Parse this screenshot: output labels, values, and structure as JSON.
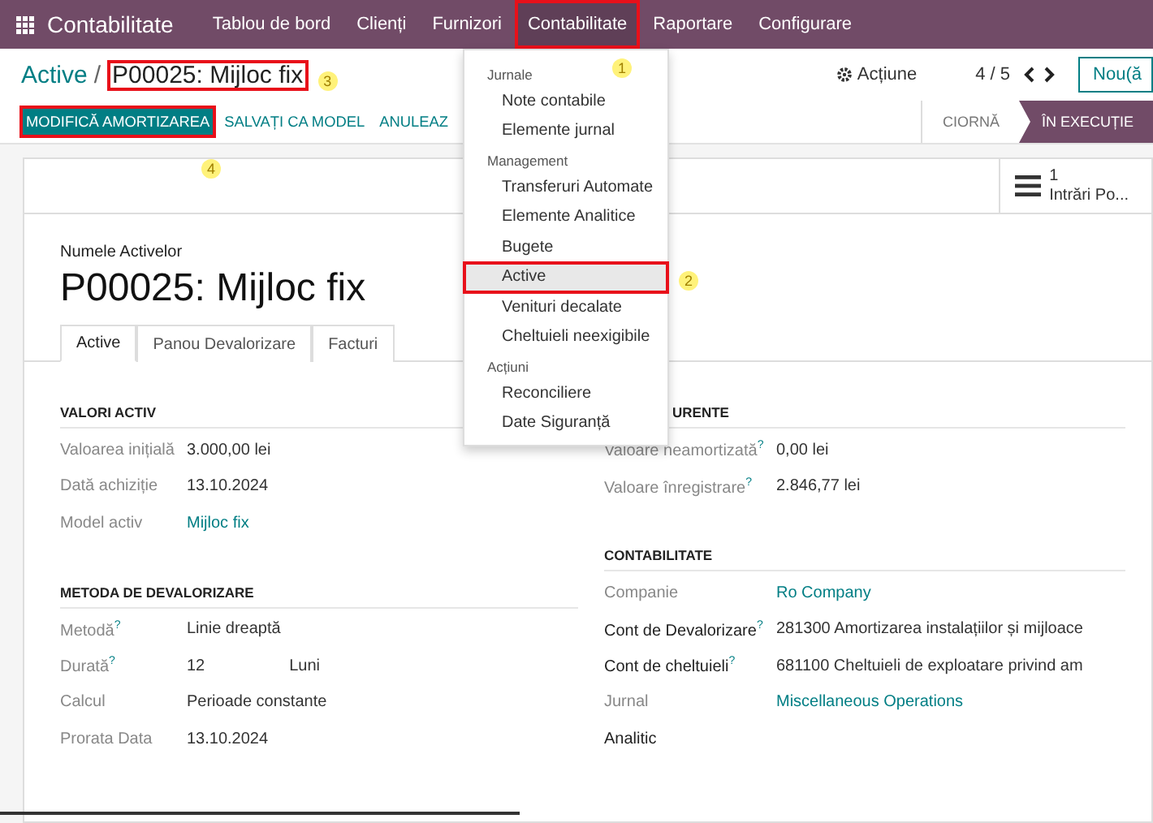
{
  "navbar": {
    "app_name": "Contabilitate",
    "items": [
      {
        "label": "Tablou de bord",
        "selected": false
      },
      {
        "label": "Clienți",
        "selected": false
      },
      {
        "label": "Furnizori",
        "selected": false
      },
      {
        "label": "Contabilitate",
        "selected": true,
        "highlighted": true,
        "callout": "1"
      },
      {
        "label": "Raportare",
        "selected": false
      },
      {
        "label": "Configurare",
        "selected": false
      }
    ]
  },
  "dropdown": {
    "sections": [
      {
        "heading": "Jurnale",
        "items": [
          {
            "label": "Note contabile",
            "selected": false
          },
          {
            "label": "Elemente jurnal",
            "selected": false
          }
        ]
      },
      {
        "heading": "Management",
        "items": [
          {
            "label": "Transferuri Automate",
            "selected": false
          },
          {
            "label": "Elemente Analitice",
            "selected": false
          },
          {
            "label": "Bugete",
            "selected": false
          },
          {
            "label": "Active",
            "selected": true,
            "highlighted": true,
            "callout": "2"
          },
          {
            "label": "Venituri decalate",
            "selected": false
          },
          {
            "label": "Cheltuieli neexigibile",
            "selected": false
          }
        ]
      },
      {
        "heading": "Acțiuni",
        "items": [
          {
            "label": "Reconciliere",
            "selected": false
          },
          {
            "label": "Date Siguranță",
            "selected": false
          }
        ]
      }
    ]
  },
  "breadcrumb": {
    "parent": "Active",
    "separator": "/",
    "current": "P00025: Mijloc fix",
    "highlighted": true,
    "callout": "3"
  },
  "control_panel": {
    "action": "Acțiune",
    "pager": "4 / 5",
    "new_button": "Nou(ă"
  },
  "action_buttons": [
    {
      "label": "MODIFICĂ AMORTIZAREA",
      "kind": "primary",
      "highlighted": true,
      "callout": "4"
    },
    {
      "label": "SALVAȚI CA MODEL",
      "kind": "secondary"
    },
    {
      "label": "ANULEAZ",
      "kind": "secondary"
    }
  ],
  "status_steps": [
    {
      "label": "CIORNĂ",
      "selected": false
    },
    {
      "label": "ÎN EXECUȚIE",
      "selected": true
    }
  ],
  "smart_button": {
    "count": "1",
    "label": "Intrări Po..."
  },
  "form": {
    "name_label": "Numele Activelor",
    "name": "P00025: Mijloc fix",
    "tabs": [
      {
        "label": "Active",
        "selected": true
      },
      {
        "label": "Panou Devalorizare",
        "selected": false
      },
      {
        "label": "Facturi",
        "selected": false
      }
    ],
    "left_groups": [
      {
        "heading": "VALORI ACTIV",
        "fields": [
          {
            "label": "Valoarea inițială",
            "value": "3.000,00 lei",
            "link": false,
            "required": false
          },
          {
            "label": "Dată achiziție",
            "value": "13.10.2024",
            "link": false,
            "required": false
          },
          {
            "label": "Model activ",
            "value": "Mijloc fix",
            "link": true,
            "required": false
          }
        ]
      },
      {
        "heading": "METODA DE DEVALORIZARE",
        "fields": [
          {
            "label": "Metodă$^{?}$",
            "value": "Linie dreaptă",
            "link": false,
            "required": false
          },
          {
            "label": "Durată$^{?}$",
            "value": "12",
            "unit": "Luni",
            "link": false,
            "required": false
          },
          {
            "label": "Calcul",
            "value": "Perioade constante",
            "link": false,
            "required": false
          },
          {
            "label": "Prorata Data",
            "value": "13.10.2024",
            "link": false,
            "required": false
          }
        ]
      }
    ],
    "right_groups": [
      {
        "heading": "URENTE",
        "fields": [
          {
            "label": "Valoare neamortizată$^{?}$",
            "value": "0,00 lei",
            "link": false,
            "required": false
          },
          {
            "label": "Valoare înregistrare$^{?}$",
            "value": "2.846,77 lei",
            "link": false,
            "required": false
          }
        ]
      },
      {
        "heading": "CONTABILITATE",
        "fields": [
          {
            "label": "Companie",
            "value": "Ro Company",
            "link": true,
            "required": false
          },
          {
            "label": "Cont de Devalorizare$^{?}$",
            "value": "281300 Amortizarea instalațiilor și mijloace",
            "link": false,
            "required": true
          },
          {
            "label": "Cont de cheltuieli$^{?}$",
            "value": "681100 Cheltuieli de exploatare privind am",
            "link": false,
            "required": true
          },
          {
            "label": "Jurnal",
            "value": "Miscellaneous Operations",
            "link": true,
            "required": false
          },
          {
            "label": "Analitic",
            "required": true
          }
        ]
      }
    ]
  }
}
